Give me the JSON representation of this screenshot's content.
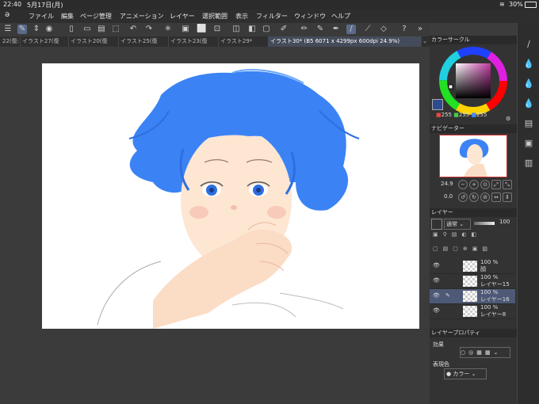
{
  "status": {
    "time": "22:40",
    "date": "5月17日(月)",
    "battery": "30%"
  },
  "menu": [
    "ファイル",
    "編集",
    "ページ管理",
    "アニメーション",
    "レイヤー",
    "選択範囲",
    "表示",
    "フィルター",
    "ウィンドウ",
    "ヘルプ"
  ],
  "tabs": [
    "22(復:",
    "イラスト27(復",
    "イラスト20(復",
    "イラスト25(復",
    "イラスト23(復",
    "イラスト29*",
    "イラスト30* (B5 6071 x 4299px 600dpi 24.9%)"
  ],
  "color_circle": {
    "title": "カラーサークル",
    "r": "255",
    "g": "255",
    "b": "255"
  },
  "navigator": {
    "title": "ナビゲーター",
    "zoom": "24.9",
    "angle": "0.0"
  },
  "layer_panel": {
    "title": "レイヤー",
    "blend_mode": "通常",
    "opacity": "100",
    "layers": [
      {
        "pct": "100 %",
        "name": "顔"
      },
      {
        "pct": "100 %",
        "name": "レイヤー15"
      },
      {
        "pct": "100 %",
        "name": "レイヤー16"
      },
      {
        "pct": "100 %",
        "name": "レイヤー8"
      }
    ]
  },
  "layer_property": {
    "title": "レイヤープロパティ",
    "effect_label": "効果",
    "expression_label": "表現色",
    "expression_value": "カラー"
  },
  "colors": {
    "accent": "#4a8cff",
    "hair": "#3b83f5",
    "skin": "#fce3cf"
  }
}
